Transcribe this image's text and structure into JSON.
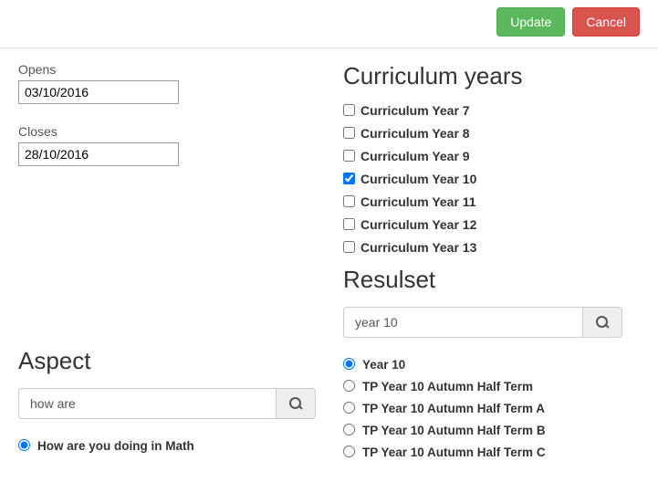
{
  "buttons": {
    "update": "Update",
    "cancel": "Cancel"
  },
  "left": {
    "opens": {
      "label": "Opens",
      "value": "03/10/2016"
    },
    "closes": {
      "label": "Closes",
      "value": "28/10/2016"
    },
    "aspect": {
      "title": "Aspect",
      "search_value": "how are",
      "options": [
        {
          "label": "How are you doing in Math",
          "selected": true
        }
      ]
    }
  },
  "right": {
    "curriculum": {
      "title": "Curriculum years",
      "items": [
        {
          "label": "Curriculum Year 7",
          "checked": false
        },
        {
          "label": "Curriculum Year 8",
          "checked": false
        },
        {
          "label": "Curriculum Year 9",
          "checked": false
        },
        {
          "label": "Curriculum Year 10",
          "checked": true
        },
        {
          "label": "Curriculum Year 11",
          "checked": false
        },
        {
          "label": "Curriculum Year 12",
          "checked": false
        },
        {
          "label": "Curriculum Year 13",
          "checked": false
        }
      ]
    },
    "resultset": {
      "title": "Resulset",
      "search_value": "year 10",
      "options": [
        {
          "label": "Year 10",
          "selected": true
        },
        {
          "label": "TP Year 10 Autumn Half Term",
          "selected": false
        },
        {
          "label": "TP Year 10 Autumn Half Term A",
          "selected": false
        },
        {
          "label": "TP Year 10 Autumn Half Term B",
          "selected": false
        },
        {
          "label": "TP Year 10 Autumn Half Term C",
          "selected": false
        }
      ]
    }
  }
}
